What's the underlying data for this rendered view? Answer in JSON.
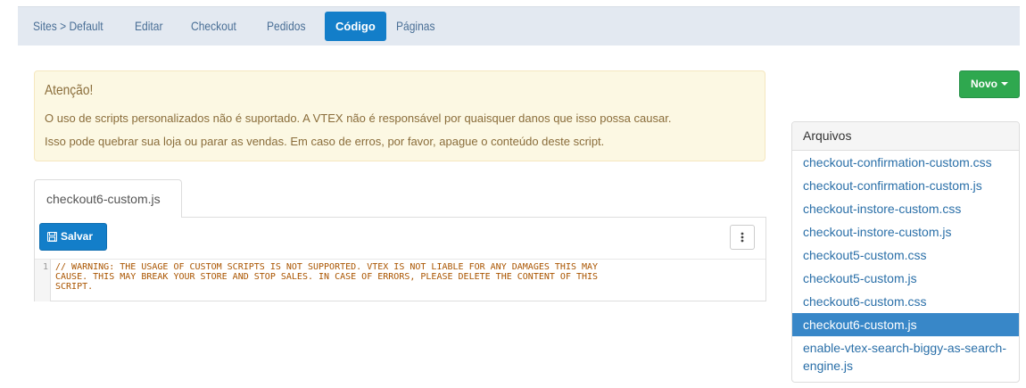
{
  "nav": {
    "breadcrumb": "Sites > Default",
    "items": [
      "Editar",
      "Checkout",
      "Pedidos",
      "Código",
      "Páginas"
    ],
    "active": "Código"
  },
  "alert": {
    "title": "Atenção!",
    "line1": "O uso de scripts personalizados não é suportado. A VTEX não é responsável por quaisquer danos que isso possa causar.",
    "line2": "Isso pode quebrar sua loja ou parar as vendas. Em caso de erros, por favor, apague o conteúdo deste script."
  },
  "editor": {
    "tab_label": "checkout6-custom.js",
    "save_label": "Salvar",
    "menu_icon": "kebab-icon",
    "line_number": "1",
    "code_lines": [
      "// WARNING: THE USAGE OF CUSTOM SCRIPTS IS NOT SUPPORTED. VTEX IS NOT LIABLE FOR ANY DAMAGES THIS MAY",
      "CAUSE. THIS MAY BREAK YOUR STORE AND STOP SALES. IN CASE OF ERRORS, PLEASE DELETE THE CONTENT OF THIS",
      "SCRIPT."
    ]
  },
  "new_button": {
    "label": "Novo"
  },
  "files": {
    "header": "Arquivos",
    "items": [
      "checkout-confirmation-custom.css",
      "checkout-confirmation-custom.js",
      "checkout-instore-custom.css",
      "checkout-instore-custom.js",
      "checkout5-custom.css",
      "checkout5-custom.js",
      "checkout6-custom.css",
      "checkout6-custom.js",
      "enable-vtex-search-biggy-as-search-engine.js"
    ],
    "selected": "checkout6-custom.js"
  },
  "colors": {
    "accent": "#137ec9",
    "success": "#2fa84f",
    "warning_bg": "#fcf8e3",
    "warning_text": "#8a6d3b",
    "nav_bg": "#e3e9f1",
    "link": "#2a6fa8"
  }
}
